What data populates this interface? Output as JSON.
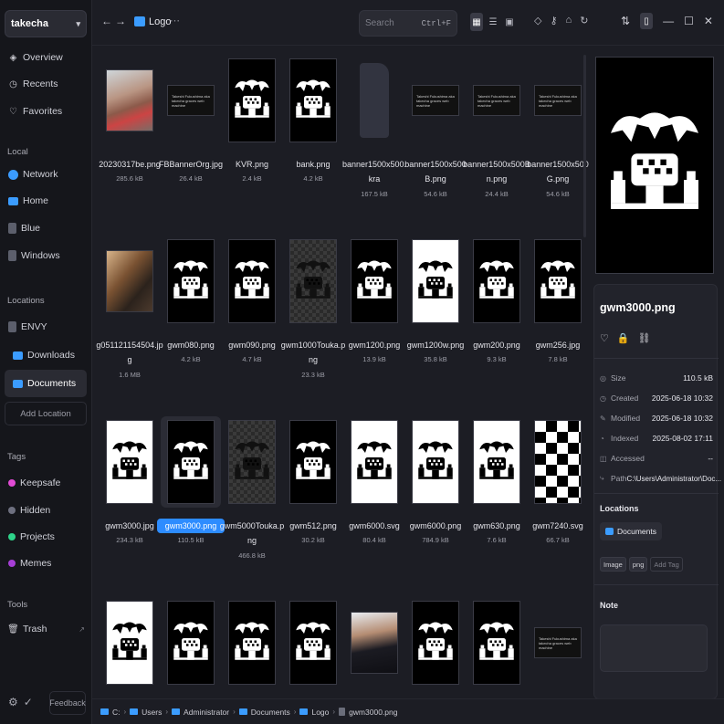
{
  "library": {
    "name": "takecha"
  },
  "sidebar": {
    "top_items": [
      {
        "label": "Overview",
        "icon": "overview-icon"
      },
      {
        "label": "Recents",
        "icon": "clock-icon"
      },
      {
        "label": "Favorites",
        "icon": "heart-icon"
      }
    ],
    "local_heading": "Local",
    "local_items": [
      {
        "label": "Network",
        "icon": "globe-icon"
      },
      {
        "label": "Home",
        "icon": "folder-icon"
      },
      {
        "label": "Blue",
        "icon": "drive-icon"
      },
      {
        "label": "Windows",
        "icon": "drive-icon"
      }
    ],
    "locations_heading": "Locations",
    "location_items": [
      {
        "label": "ENVY",
        "icon": "drive-icon"
      },
      {
        "label": "Downloads",
        "icon": "folder-icon"
      },
      {
        "label": "Documents",
        "icon": "folder-icon"
      }
    ],
    "add_location": "Add Location",
    "tags_heading": "Tags",
    "tags": [
      {
        "label": "Keepsafe",
        "color": "#e24bd5"
      },
      {
        "label": "Hidden",
        "color": "#6e7080"
      },
      {
        "label": "Projects",
        "color": "#2ed48a"
      },
      {
        "label": "Memes",
        "color": "#a63ed6"
      }
    ],
    "tools_heading": "Tools",
    "tools": [
      {
        "label": "Trash",
        "icon": "trash-icon"
      }
    ],
    "feedback": "Feedback"
  },
  "topbar": {
    "folder_title": "Logo",
    "search_placeholder": "Search",
    "search_shortcut": "Ctrl+F"
  },
  "files": [
    {
      "name": "20230317be.png",
      "size": "285.6 kB",
      "kind": "photo1"
    },
    {
      "name": "FBBannerOrg.jpg",
      "size": "26.4 kB",
      "kind": "banner"
    },
    {
      "name": "KVR.png",
      "size": "2.4 kB",
      "kind": "logo-black"
    },
    {
      "name": "bank.png",
      "size": "4.2 kB",
      "kind": "logo-black"
    },
    {
      "name": "banner1500x500.kra",
      "size": "167.5 kB",
      "kind": "doc"
    },
    {
      "name": "banner1500x500B.png",
      "size": "54.6 kB",
      "kind": "banner"
    },
    {
      "name": "banner1500x500Bn.png",
      "size": "24.4 kB",
      "kind": "banner"
    },
    {
      "name": "banner1500x500G.png",
      "size": "54.6 kB",
      "kind": "banner"
    },
    {
      "name": "g051121154504.jpg",
      "size": "1.6 MB",
      "kind": "photo2"
    },
    {
      "name": "gwm080.png",
      "size": "4.2 kB",
      "kind": "logo-black"
    },
    {
      "name": "gwm090.png",
      "size": "4.7 kB",
      "kind": "logo-black"
    },
    {
      "name": "gwm1000Touka.png",
      "size": "23.3 kB",
      "kind": "logo-trans"
    },
    {
      "name": "gwm1200.png",
      "size": "13.9 kB",
      "kind": "logo-black"
    },
    {
      "name": "gwm1200w.png",
      "size": "35.8 kB",
      "kind": "logo-white"
    },
    {
      "name": "gwm200.png",
      "size": "9.3 kB",
      "kind": "logo-black"
    },
    {
      "name": "gwm256.jpg",
      "size": "7.8 kB",
      "kind": "logo-black"
    },
    {
      "name": "gwm3000.jpg",
      "size": "234.3 kB",
      "kind": "logo-white"
    },
    {
      "name": "gwm3000.png",
      "size": "110.5 kB",
      "kind": "logo-black",
      "selected": true
    },
    {
      "name": "gwm5000Touka.png",
      "size": "466.8 kB",
      "kind": "logo-trans"
    },
    {
      "name": "gwm512.png",
      "size": "30.2 kB",
      "kind": "logo-black"
    },
    {
      "name": "gwm6000.svg",
      "size": "80.4 kB",
      "kind": "logo-white"
    },
    {
      "name": "gwm6000.png",
      "size": "784.9 kB",
      "kind": "logo-white"
    },
    {
      "name": "gwm630.png",
      "size": "7.6 kB",
      "kind": "logo-white"
    },
    {
      "name": "gwm7240.svg",
      "size": "66.7 kB",
      "kind": "check"
    },
    {
      "name": "",
      "size": "",
      "kind": "logo-white"
    },
    {
      "name": "",
      "size": "",
      "kind": "logo-black"
    },
    {
      "name": "",
      "size": "",
      "kind": "logo-black"
    },
    {
      "name": "",
      "size": "",
      "kind": "logo-black"
    },
    {
      "name": "",
      "size": "",
      "kind": "photo3"
    },
    {
      "name": "",
      "size": "",
      "kind": "logo-black"
    },
    {
      "name": "",
      "size": "",
      "kind": "logo-black"
    },
    {
      "name": "",
      "size": "",
      "kind": "banner"
    }
  ],
  "banner_text": "Takeshi Fukushima aka takecha graces web machine",
  "inspector": {
    "file_name": "gwm3000.png",
    "meta": [
      {
        "key": "Size",
        "value": "110.5 kB",
        "icon": "size-icon"
      },
      {
        "key": "Created",
        "value": "2025-06-18 10:32",
        "icon": "clock-icon"
      },
      {
        "key": "Modified",
        "value": "2025-06-18 10:32",
        "icon": "edit-icon"
      },
      {
        "key": "Indexed",
        "value": "2025-08-02 17:11",
        "icon": "index-icon"
      },
      {
        "key": "Accessed",
        "value": "--",
        "icon": "eye-icon"
      },
      {
        "key": "Path",
        "value": "C:\\Users\\Administrator\\Doc...",
        "icon": "path-icon"
      }
    ],
    "locations_title": "Locations",
    "location": "Documents",
    "tags": [
      "Image",
      "png"
    ],
    "add_tag": "Add Tag",
    "note_title": "Note"
  },
  "pathbar": {
    "segments": [
      "C:",
      "Users",
      "Administrator",
      "Documents",
      "Logo"
    ],
    "file": "gwm3000.png"
  }
}
